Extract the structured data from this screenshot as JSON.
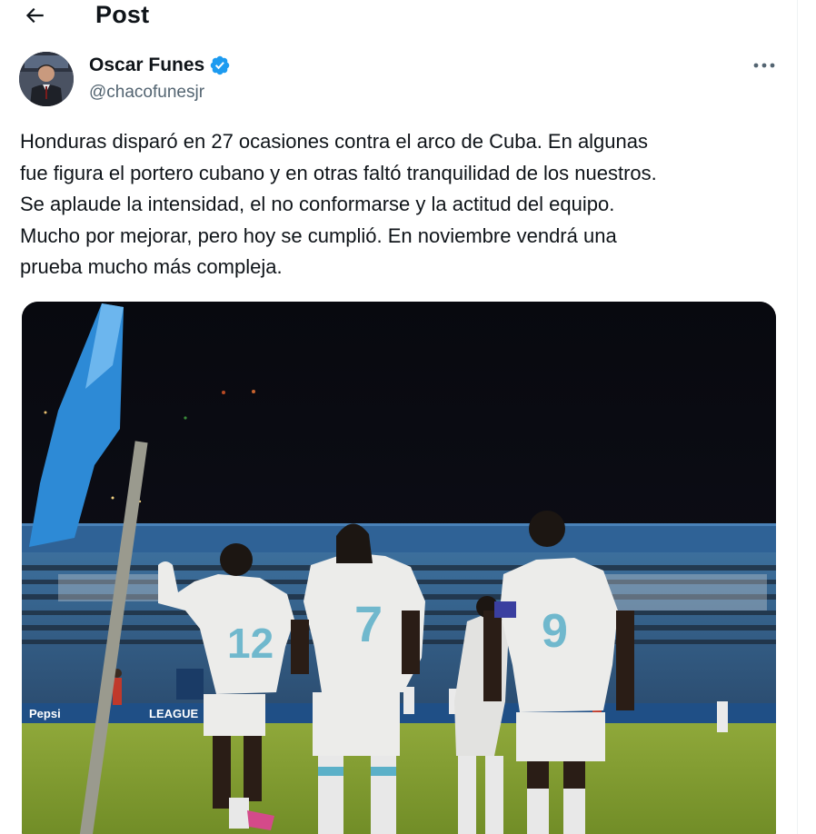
{
  "header": {
    "title": "Post"
  },
  "author": {
    "display_name": "Oscar Funes",
    "handle": "@chacofunesjr",
    "verified": true,
    "verified_color": "#1d9bf0"
  },
  "tweet": {
    "lines": [
      "Honduras disparó en 27 ocasiones contra el arco de Cuba. En algunas",
      "fue figura el portero cubano y en otras faltó tranquilidad de los nuestros.",
      "Se aplaude la intensidad, el no conformarse y la actitud del equipo.",
      "Mucho por mejorar, pero hoy se cumplió. En noviembre vendrá una",
      "prueba mucho más compleja."
    ]
  },
  "media": {
    "jersey_numbers": [
      "12",
      "7",
      "9"
    ],
    "board_text": [
      "Pepsi",
      "LEAGUE"
    ]
  },
  "icons": {
    "back": "arrow-left-icon",
    "verified": "verified-badge-icon",
    "more": "more-horizontal-icon"
  },
  "colors": {
    "text_primary": "#0f1419",
    "text_secondary": "#536471",
    "accent": "#1d9bf0"
  }
}
